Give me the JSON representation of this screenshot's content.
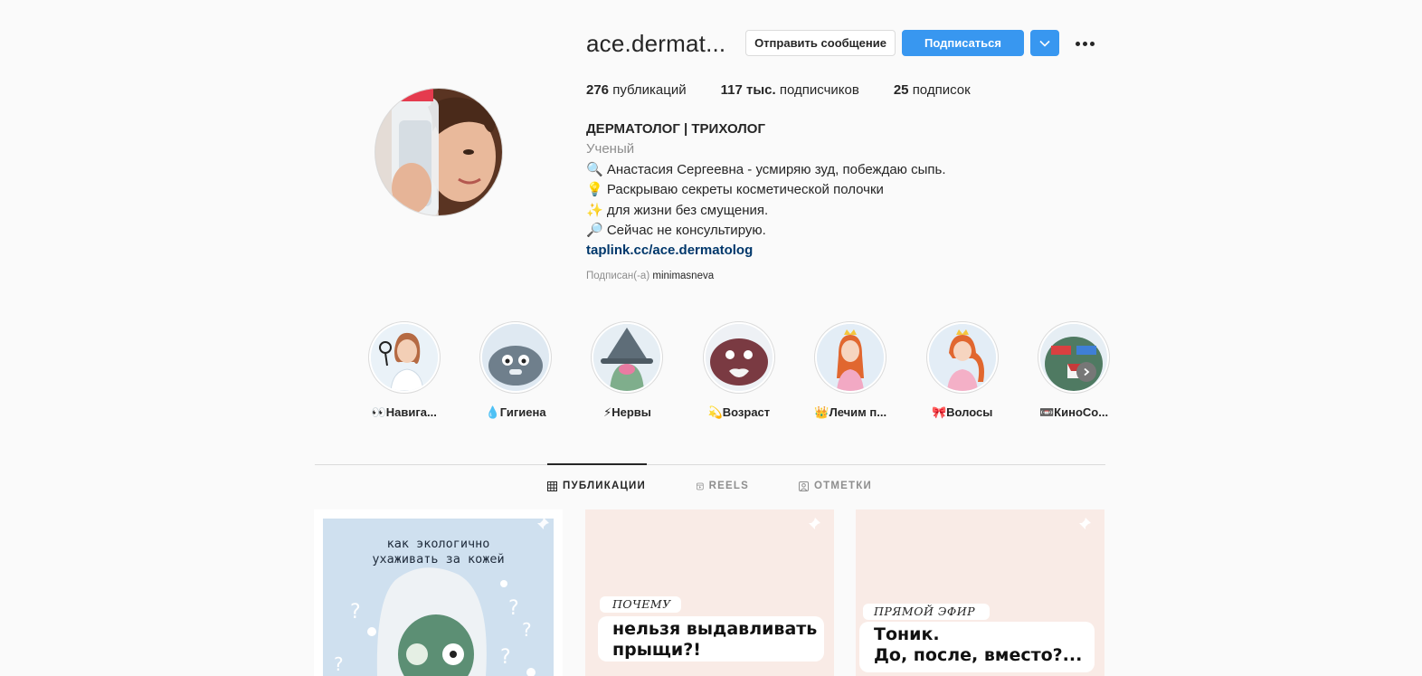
{
  "profile": {
    "username": "ace.dermat...",
    "message_button": "Отправить сообщение",
    "follow_button": "Подписаться",
    "stats": {
      "posts_count": "276",
      "posts_label": "публикаций",
      "followers_count": "117 тыс.",
      "followers_label": "подписчиков",
      "following_count": "25",
      "following_label": "подписок"
    },
    "bio": {
      "name": "ДЕРМАТОЛОГ | ТРИХОЛОГ",
      "category": "Ученый",
      "line1": "🔍 Анастасия Сергеевна - усмиряю зуд, побеждаю сыпь.",
      "line2": "💡 Раскрываю секреты косметической полочки",
      "line3": "✨ для жизни без смущения.",
      "line4": "🔎 Сейчас не консультирую.",
      "link": "taplink.cc/ace.dermatolog"
    },
    "followed_by_prefix": "Подписан(-а)",
    "followed_by_user": "minimasneva"
  },
  "highlights": [
    {
      "label": "👀Навига..."
    },
    {
      "label": "💧Гигиена"
    },
    {
      "label": "⚡Нервы"
    },
    {
      "label": "💫Возраст"
    },
    {
      "label": "👑Лечим п..."
    },
    {
      "label": "🎀Волосы"
    },
    {
      "label": "📼КиноСо..."
    }
  ],
  "tabs": [
    {
      "label": "ПУБЛИКАЦИИ",
      "icon": "grid-icon",
      "active": true
    },
    {
      "label": "REELS",
      "icon": "reels-icon",
      "active": false
    },
    {
      "label": "ОТМЕТКИ",
      "icon": "tagged-icon",
      "active": false
    }
  ],
  "posts": [
    {
      "title_line1": "как экологично",
      "title_line2": "ухаживать за кожей"
    },
    {
      "small": "ПОЧЕМУ",
      "big_line1": "нельзя выдавливать",
      "big_line2": "прыщи?!"
    },
    {
      "small": "ПРЯМОЙ ЭФИР",
      "big_line1": "Тоник.",
      "big_line2": "До, после, вместо?..."
    }
  ],
  "colors": {
    "accent": "#3897f0",
    "link": "#00376b",
    "muted": "#8e8e8e",
    "text": "#262626",
    "background": "#fafafa"
  }
}
